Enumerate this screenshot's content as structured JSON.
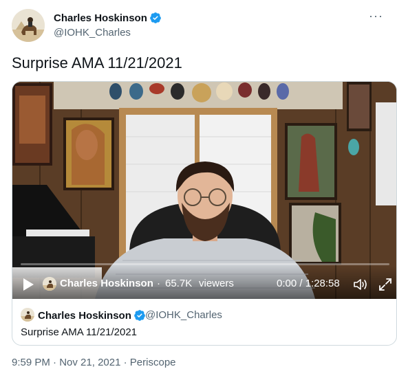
{
  "author": {
    "name": "Charles Hoskinson",
    "handle": "@IOHK_Charles"
  },
  "tweet": {
    "text": "Surprise AMA 11/21/2021"
  },
  "video": {
    "broadcaster": "Charles Hoskinson",
    "separator": "·",
    "viewers_count": "65.7K",
    "viewers_label": "viewers",
    "time": "0:00 / 1:28:58",
    "progress_fraction": 0
  },
  "quoted": {
    "name": "Charles Hoskinson",
    "handle": "@IOHK_Charles",
    "text": "Surprise AMA 11/21/2021"
  },
  "meta": {
    "time": "9:59 PM",
    "separator1": " · ",
    "date": "Nov 21, 2021",
    "separator2": " · ",
    "source": "Periscope"
  },
  "colors": {
    "verified": "#1d9bf0",
    "secondary_text": "#536471",
    "primary_text": "#0f1419",
    "border": "#cfd9de"
  },
  "icons": [
    "verified-badge-icon",
    "more-options-icon",
    "play-icon",
    "volume-icon",
    "fullscreen-icon"
  ]
}
